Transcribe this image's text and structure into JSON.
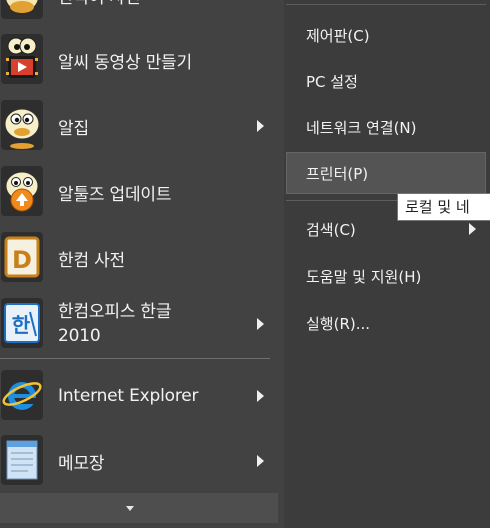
{
  "programs": [
    {
      "label": "한국어 사전",
      "icon": "alzip-mascot-icon"
    },
    {
      "label": "알씨 동영상 만들기",
      "icon": "alsee-movie-maker-icon"
    },
    {
      "label": "알집",
      "icon": "alzip-icon",
      "submenu": true
    },
    {
      "label": "알툴즈 업데이트",
      "icon": "altools-update-icon"
    },
    {
      "label": "한컴 사전",
      "icon": "hancom-dictionary-icon"
    },
    {
      "label_line1": "한컴오피스 한글",
      "label_line2": "2010",
      "icon": "hancom-hangul-icon",
      "submenu": true
    },
    {
      "label": "Internet Explorer",
      "icon": "internet-explorer-icon",
      "submenu": true
    },
    {
      "label": "메모장",
      "icon": "notepad-icon",
      "submenu": true
    }
  ],
  "links": [
    {
      "label": "제어판(C)"
    },
    {
      "label": "PC 설정"
    },
    {
      "label": "네트워크 연결(N)"
    },
    {
      "label": "프린터(P)",
      "highlighted": true
    },
    {
      "label": "검색(C)",
      "submenu": true
    },
    {
      "label": "도움말 및 지원(H)"
    },
    {
      "label": "실행(R)..."
    }
  ],
  "tooltip": "로컬 및 네",
  "colors": {
    "menu_bg": "#424242",
    "highlight": "#545454",
    "text": "#f2f2f2"
  }
}
